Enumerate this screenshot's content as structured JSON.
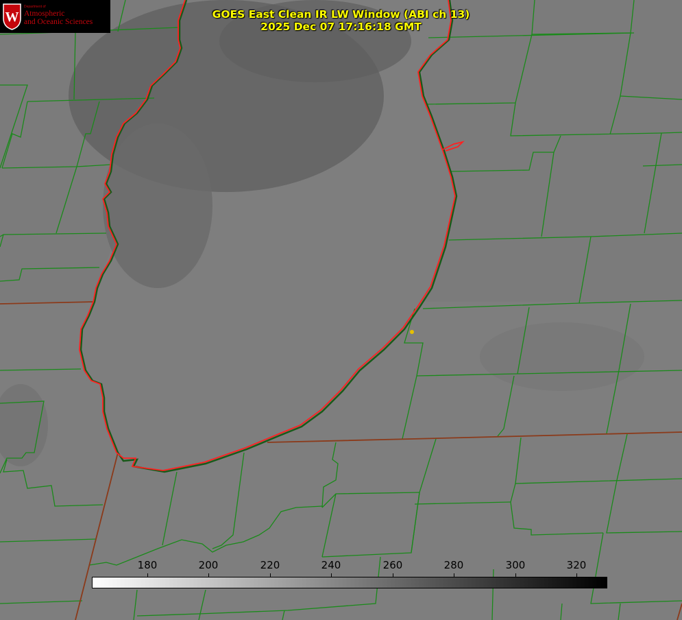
{
  "logo": {
    "department": "Department of",
    "line1": "Atmospheric",
    "line2": "and Oceanic Sciences",
    "crest_letter": "W",
    "colors": {
      "crest_red": "#c5050c",
      "background": "#000000"
    }
  },
  "title": {
    "line1": "GOES East Clean IR LW Window (ABI ch 13)",
    "line2": "2025 Dec 07 17:16:18 GMT",
    "color": "#ffff00"
  },
  "map": {
    "feature": "lake outline with county boundaries",
    "colors": {
      "background": "#7f7f7f",
      "lake_shore": "#ff2020",
      "county_lines": "#1a8a1a",
      "state_lines": "#8b3a1a",
      "point_marker": "#e6c000"
    }
  },
  "colorbar": {
    "ticks": [
      "180",
      "200",
      "220",
      "240",
      "260",
      "280",
      "300",
      "320"
    ],
    "range": [
      162,
      330
    ],
    "from_color": "#ffffff",
    "to_color": "#000000"
  }
}
